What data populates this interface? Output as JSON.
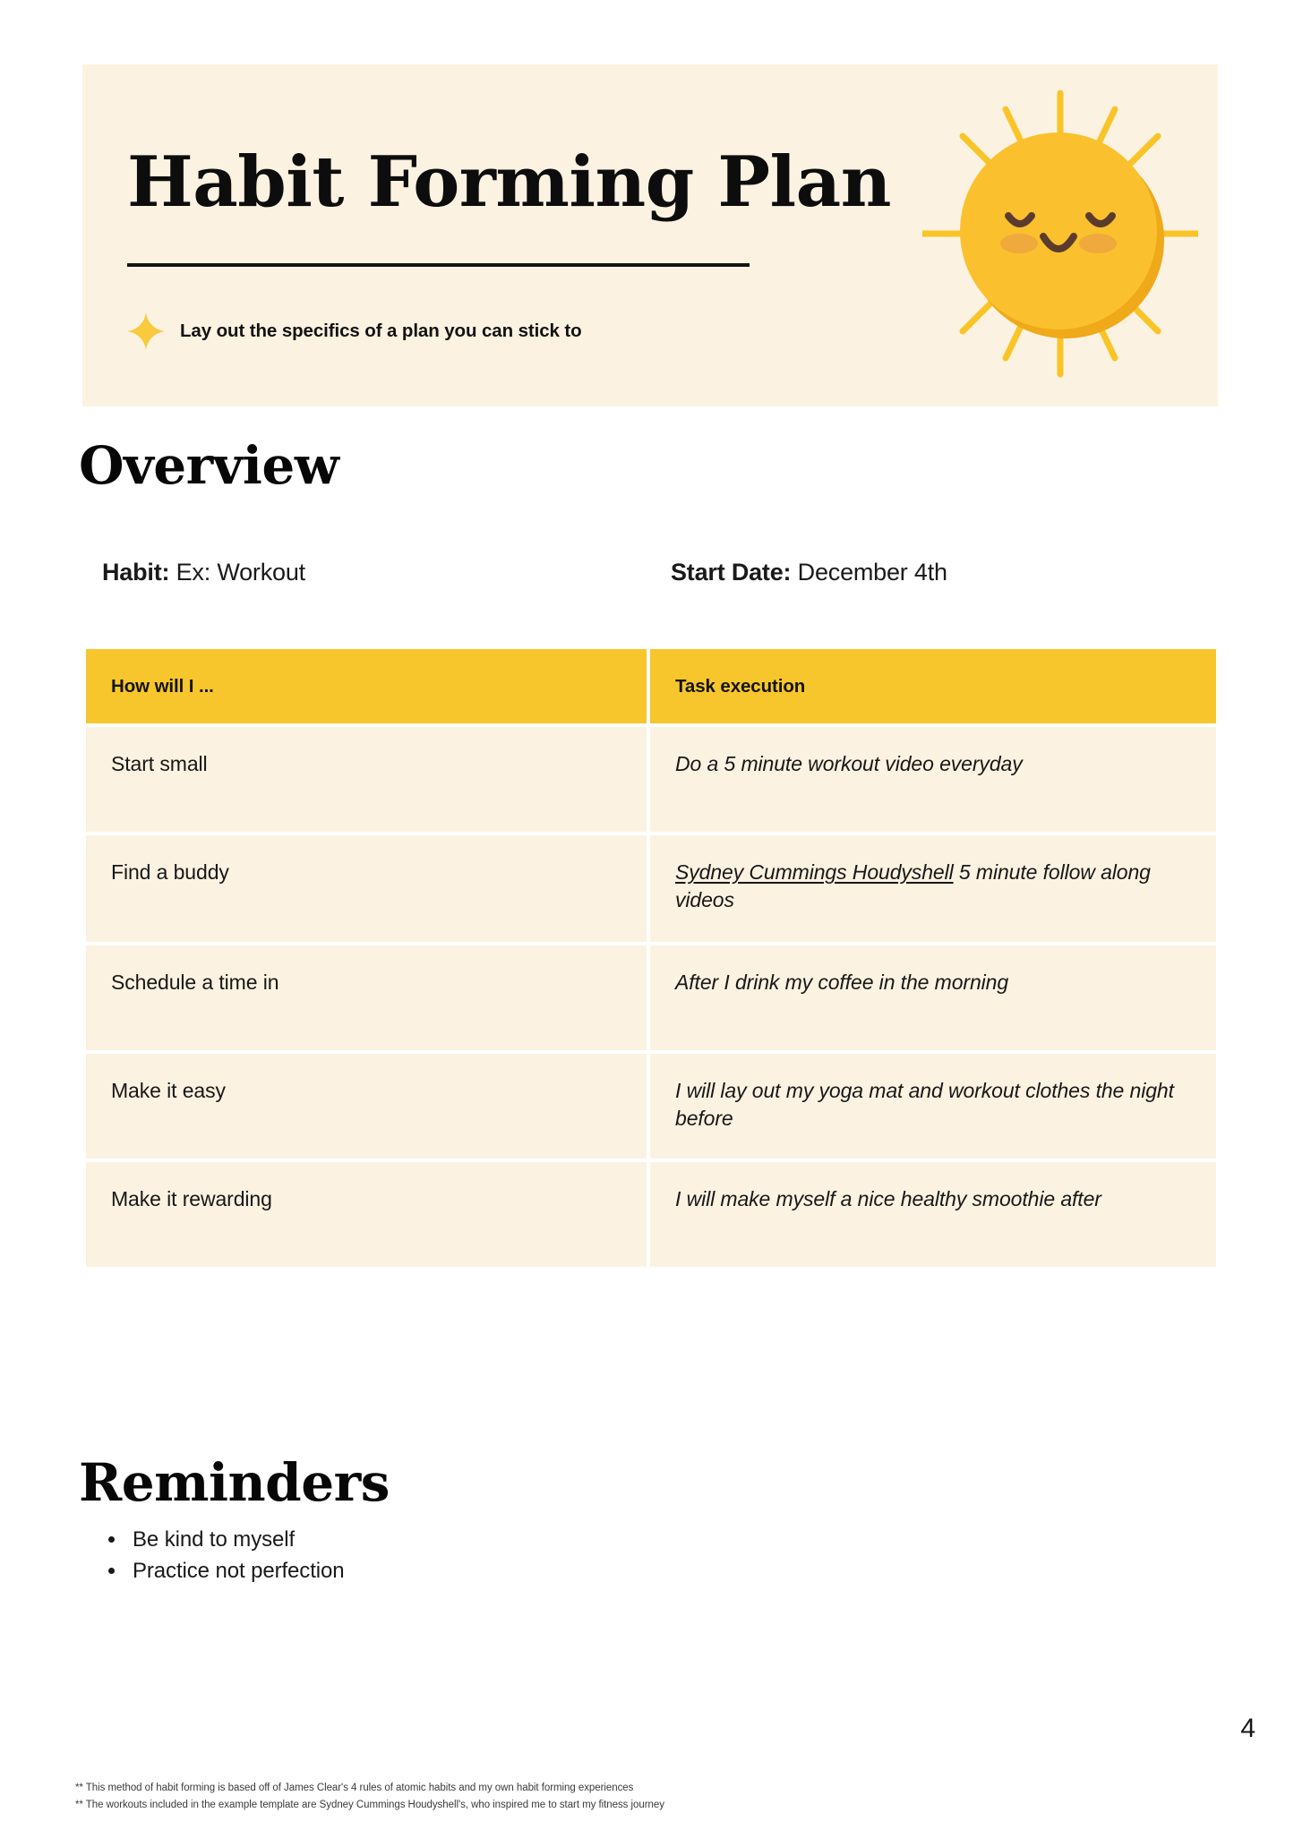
{
  "banner": {
    "title": "Habit Forming Plan",
    "subtitle": "Lay out the specifics of a plan you can stick to",
    "sparkle_icon": "sparkle-icon",
    "sun_icon": "smiling-sun-icon"
  },
  "overview": {
    "heading": "Overview",
    "habit_label": "Habit:",
    "habit_value": "Ex: Workout",
    "start_date_label": "Start Date:",
    "start_date_value": "December 4th"
  },
  "table": {
    "headers": [
      "How will I ...",
      "Task execution"
    ],
    "rows": [
      {
        "label": "Start small",
        "value": "Do a 5 minute workout video everyday",
        "link": "",
        "value_after_link": ""
      },
      {
        "label": "Find a buddy",
        "value": "",
        "link": "Sydney Cummings Houdyshell",
        "value_after_link": "  5 minute follow along videos"
      },
      {
        "label": "Schedule a time in",
        "value": "After I drink my coffee in the morning",
        "link": "",
        "value_after_link": ""
      },
      {
        "label": "Make it easy",
        "value": "I will lay out my yoga mat and workout clothes the night before",
        "link": "",
        "value_after_link": ""
      },
      {
        "label": "Make it rewarding",
        "value": " I will make myself a nice healthy smoothie after",
        "link": "",
        "value_after_link": ""
      }
    ]
  },
  "reminders": {
    "heading": "Reminders",
    "items": [
      "Be kind to myself",
      "Practice not perfection"
    ]
  },
  "footer": {
    "page_number": "4",
    "footnotes": [
      "** This method of habit forming is based off of James Clear's 4 rules of atomic habits and my own habit forming experiences",
      "** The workouts included in the example template are Sydney Cummings Houdyshell's, who inspired me to start my fitness journey"
    ]
  },
  "colors": {
    "cream": "#FCF2E1",
    "yellow": "#F7C62C",
    "sun_body": "#FBC02D",
    "sun_shadow": "#EFA919",
    "sun_face": "#5B3B2E",
    "sun_cheek": "#F0A93C",
    "ray": "#F9C427",
    "page_background": "#FFFFFF"
  }
}
